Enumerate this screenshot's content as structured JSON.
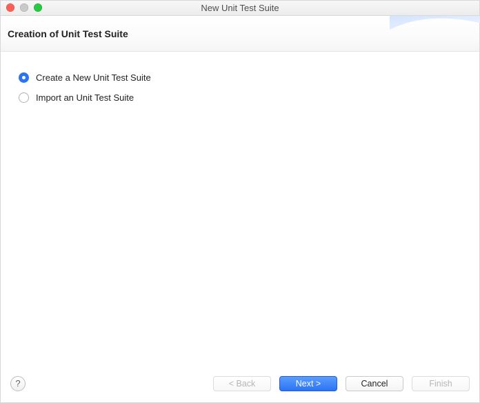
{
  "window": {
    "title": "New Unit Test Suite"
  },
  "banner": {
    "title": "Creation of Unit Test Suite"
  },
  "options": {
    "create": {
      "label": "Create a New Unit Test Suite",
      "selected": true
    },
    "import": {
      "label": "Import an Unit Test Suite",
      "selected": false
    }
  },
  "footer": {
    "help_label": "?",
    "back_label": "< Back",
    "next_label": "Next >",
    "cancel_label": "Cancel",
    "finish_label": "Finish"
  }
}
